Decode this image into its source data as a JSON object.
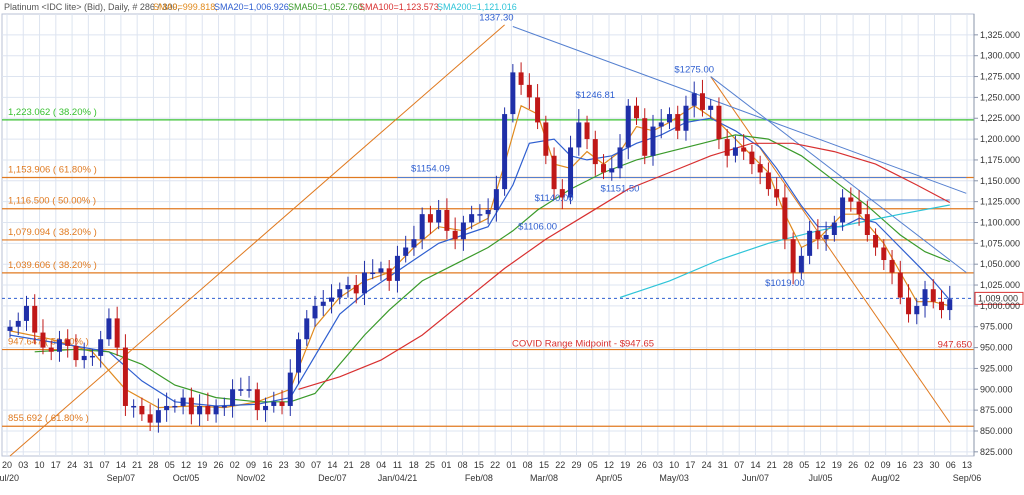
{
  "header": {
    "instrument": "Platinum <IDC lite> (Bid), Daily, # 286 / 300,",
    "sma9": "SMA9=999.818,",
    "sma20": "SMA20=1,006.926,",
    "sma50": "SMA50=1,052.760,",
    "sma100": "SMA100=1,123.573,",
    "sma200": "SMA200=1,121.016"
  },
  "colors": {
    "up_candle": "#1f2fa8",
    "down_candle": "#c01818",
    "sma9": "#e08a1e",
    "sma20": "#2f5fd0",
    "sma50": "#3a9a2a",
    "sma100": "#d83030",
    "sma200": "#2ec4d8",
    "fib_lines": "#e07a20",
    "fib_green": "#38c030",
    "trend_lines": "#5580d0",
    "grid": "#dde4f0"
  },
  "chart_data": {
    "type": "candlestick",
    "y_axis": {
      "range": [
        820,
        1350
      ],
      "ticks": [
        825,
        850,
        875,
        900,
        925,
        950,
        975,
        1000,
        1025,
        1050,
        1075,
        1100,
        1125,
        1150,
        1175,
        1200,
        1225,
        1250,
        1275,
        1300,
        1325
      ],
      "tick_labels": [
        "825.000",
        "850.000",
        "875.000",
        "900.000",
        "925.000",
        "950.000",
        "975.000",
        "1,000.000",
        "1,025.000",
        "1,050.000",
        "1,075.000",
        "1,100.000",
        "1,125.000",
        "1,150.000",
        "1,175.000",
        "1,200.000",
        "1,225.000",
        "1,250.000",
        "1,275.000",
        "1,300.000",
        "1,325.000"
      ]
    },
    "x_axis": {
      "day_ticks": [
        "20",
        "03",
        "10",
        "17",
        "24",
        "31",
        "07",
        "14",
        "21",
        "28",
        "05",
        "12",
        "19",
        "26",
        "02",
        "09",
        "16",
        "23",
        "30",
        "07",
        "14",
        "21",
        "28",
        "04",
        "11",
        "18",
        "25",
        "01",
        "08",
        "15",
        "22",
        "01",
        "08",
        "15",
        "22",
        "29",
        "05",
        "12",
        "19",
        "26",
        "03",
        "10",
        "17",
        "24",
        "31",
        "07",
        "14",
        "21",
        "28",
        "05",
        "12",
        "19",
        "26",
        "02",
        "09",
        "16",
        "23",
        "30",
        "06",
        "13"
      ],
      "month_labels": [
        {
          "label": "Jul/20",
          "slot": 0
        },
        {
          "label": "Sep/07",
          "slot": 7
        },
        {
          "label": "Oct/05",
          "slot": 11
        },
        {
          "label": "Nov/02",
          "slot": 15
        },
        {
          "label": "Dec/07",
          "slot": 20
        },
        {
          "label": "Jan/04/21",
          "slot": 24
        },
        {
          "label": "Feb/08",
          "slot": 29
        },
        {
          "label": "Mar/08",
          "slot": 33
        },
        {
          "label": "Apr/05",
          "slot": 37
        },
        {
          "label": "May/03",
          "slot": 41
        },
        {
          "label": "Jun/07",
          "slot": 46
        },
        {
          "label": "Jul/05",
          "slot": 50
        },
        {
          "label": "Aug/02",
          "slot": 54
        },
        {
          "label": "Sep/06",
          "slot": 59
        }
      ]
    },
    "close_series": [
      [
        0,
        975
      ],
      [
        1,
        982
      ],
      [
        2,
        1000
      ],
      [
        3,
        968
      ],
      [
        4,
        950
      ],
      [
        5,
        945
      ],
      [
        6,
        960
      ],
      [
        7,
        952
      ],
      [
        8,
        935
      ],
      [
        9,
        940
      ],
      [
        10,
        940
      ],
      [
        11,
        960
      ],
      [
        12,
        985
      ],
      [
        13,
        950
      ],
      [
        14,
        880
      ],
      [
        15,
        880
      ],
      [
        16,
        870
      ],
      [
        17,
        860
      ],
      [
        18,
        875
      ],
      [
        19,
        880
      ],
      [
        20,
        880
      ],
      [
        21,
        890
      ],
      [
        22,
        870
      ],
      [
        23,
        880
      ],
      [
        24,
        870
      ],
      [
        25,
        880
      ],
      [
        26,
        880
      ],
      [
        27,
        900
      ],
      [
        28,
        900
      ],
      [
        29,
        900
      ],
      [
        30,
        875
      ],
      [
        31,
        880
      ],
      [
        32,
        885
      ],
      [
        33,
        880
      ],
      [
        34,
        920
      ],
      [
        35,
        960
      ],
      [
        36,
        985
      ],
      [
        37,
        1000
      ],
      [
        38,
        1005
      ],
      [
        39,
        1010
      ],
      [
        40,
        1020
      ],
      [
        41,
        1025
      ],
      [
        42,
        1015
      ],
      [
        43,
        1040
      ],
      [
        44,
        1040
      ],
      [
        45,
        1045
      ],
      [
        46,
        1030
      ],
      [
        47,
        1060
      ],
      [
        48,
        1070
      ],
      [
        49,
        1080
      ],
      [
        50,
        1110
      ],
      [
        51,
        1100
      ],
      [
        52,
        1115
      ],
      [
        53,
        1090
      ],
      [
        54,
        1080
      ],
      [
        55,
        1100
      ],
      [
        56,
        1110
      ],
      [
        57,
        1110
      ],
      [
        58,
        1115
      ],
      [
        59,
        1140
      ],
      [
        60,
        1230
      ],
      [
        61,
        1280
      ],
      [
        62,
        1265
      ],
      [
        63,
        1250
      ],
      [
        64,
        1220
      ],
      [
        65,
        1180
      ],
      [
        66,
        1140
      ],
      [
        67,
        1130
      ],
      [
        68,
        1190
      ],
      [
        69,
        1220
      ],
      [
        70,
        1200
      ],
      [
        71,
        1170
      ],
      [
        72,
        1160
      ],
      [
        73,
        1165
      ],
      [
        74,
        1190
      ],
      [
        75,
        1240
      ],
      [
        76,
        1225
      ],
      [
        77,
        1180
      ],
      [
        78,
        1215
      ],
      [
        79,
        1220
      ],
      [
        80,
        1230
      ],
      [
        81,
        1210
      ],
      [
        82,
        1240
      ],
      [
        83,
        1255
      ],
      [
        84,
        1235
      ],
      [
        85,
        1240
      ],
      [
        86,
        1200
      ],
      [
        87,
        1180
      ],
      [
        88,
        1190
      ],
      [
        89,
        1185
      ],
      [
        90,
        1170
      ],
      [
        91,
        1160
      ],
      [
        92,
        1140
      ],
      [
        93,
        1130
      ],
      [
        94,
        1080
      ],
      [
        95,
        1040
      ],
      [
        96,
        1060
      ],
      [
        97,
        1090
      ],
      [
        98,
        1080
      ],
      [
        99,
        1085
      ],
      [
        100,
        1100
      ],
      [
        101,
        1130
      ],
      [
        102,
        1125
      ],
      [
        103,
        1110
      ],
      [
        104,
        1085
      ],
      [
        105,
        1070
      ],
      [
        106,
        1055
      ],
      [
        107,
        1040
      ],
      [
        108,
        1010
      ],
      [
        109,
        990
      ],
      [
        110,
        1000
      ],
      [
        111,
        1020
      ],
      [
        112,
        1005
      ],
      [
        113,
        995
      ],
      [
        114,
        1008
      ]
    ],
    "moving_averages": [
      {
        "name": "SMA9",
        "points": [
          [
            0,
            970
          ],
          [
            5,
            960
          ],
          [
            10,
            945
          ],
          [
            14,
            900
          ],
          [
            18,
            878
          ],
          [
            22,
            880
          ],
          [
            26,
            878
          ],
          [
            30,
            885
          ],
          [
            34,
            900
          ],
          [
            37,
            975
          ],
          [
            40,
            1010
          ],
          [
            43,
            1030
          ],
          [
            46,
            1040
          ],
          [
            49,
            1070
          ],
          [
            52,
            1095
          ],
          [
            55,
            1090
          ],
          [
            58,
            1105
          ],
          [
            60,
            1170
          ],
          [
            62,
            1240
          ],
          [
            64,
            1230
          ],
          [
            66,
            1170
          ],
          [
            68,
            1165
          ],
          [
            70,
            1185
          ],
          [
            72,
            1170
          ],
          [
            74,
            1185
          ],
          [
            76,
            1215
          ],
          [
            78,
            1210
          ],
          [
            80,
            1220
          ],
          [
            83,
            1240
          ],
          [
            86,
            1220
          ],
          [
            89,
            1190
          ],
          [
            92,
            1160
          ],
          [
            94,
            1110
          ],
          [
            96,
            1070
          ],
          [
            98,
            1080
          ],
          [
            101,
            1110
          ],
          [
            103,
            1110
          ],
          [
            106,
            1075
          ],
          [
            108,
            1040
          ],
          [
            110,
            1005
          ],
          [
            112,
            1005
          ],
          [
            114,
            1000
          ]
        ]
      },
      {
        "name": "SMA20",
        "points": [
          [
            0,
            965
          ],
          [
            6,
            955
          ],
          [
            12,
            945
          ],
          [
            16,
            910
          ],
          [
            20,
            885
          ],
          [
            25,
            880
          ],
          [
            30,
            882
          ],
          [
            34,
            890
          ],
          [
            37,
            940
          ],
          [
            40,
            990
          ],
          [
            43,
            1015
          ],
          [
            46,
            1035
          ],
          [
            49,
            1055
          ],
          [
            52,
            1075
          ],
          [
            55,
            1085
          ],
          [
            58,
            1095
          ],
          [
            61,
            1145
          ],
          [
            63,
            1195
          ],
          [
            66,
            1200
          ],
          [
            68,
            1180
          ],
          [
            70,
            1175
          ],
          [
            73,
            1180
          ],
          [
            76,
            1195
          ],
          [
            79,
            1205
          ],
          [
            82,
            1220
          ],
          [
            85,
            1225
          ],
          [
            88,
            1210
          ],
          [
            91,
            1190
          ],
          [
            93,
            1165
          ],
          [
            96,
            1120
          ],
          [
            98,
            1095
          ],
          [
            101,
            1095
          ],
          [
            103,
            1105
          ],
          [
            105,
            1100
          ],
          [
            108,
            1070
          ],
          [
            110,
            1050
          ],
          [
            112,
            1030
          ],
          [
            114,
            1007
          ]
        ]
      },
      {
        "name": "SMA50",
        "points": [
          [
            3,
            945
          ],
          [
            8,
            948
          ],
          [
            12,
            945
          ],
          [
            16,
            930
          ],
          [
            20,
            905
          ],
          [
            25,
            890
          ],
          [
            30,
            885
          ],
          [
            34,
            885
          ],
          [
            37,
            895
          ],
          [
            40,
            930
          ],
          [
            43,
            965
          ],
          [
            46,
            995
          ],
          [
            50,
            1030
          ],
          [
            54,
            1050
          ],
          [
            58,
            1070
          ],
          [
            61,
            1090
          ],
          [
            64,
            1115
          ],
          [
            68,
            1140
          ],
          [
            72,
            1160
          ],
          [
            76,
            1175
          ],
          [
            80,
            1185
          ],
          [
            84,
            1195
          ],
          [
            88,
            1205
          ],
          [
            92,
            1200
          ],
          [
            96,
            1180
          ],
          [
            100,
            1150
          ],
          [
            104,
            1120
          ],
          [
            108,
            1085
          ],
          [
            111,
            1065
          ],
          [
            114,
            1053
          ]
        ]
      },
      {
        "name": "SMA100",
        "points": [
          [
            35,
            900
          ],
          [
            40,
            915
          ],
          [
            45,
            935
          ],
          [
            50,
            965
          ],
          [
            55,
            1005
          ],
          [
            60,
            1045
          ],
          [
            65,
            1080
          ],
          [
            70,
            1110
          ],
          [
            75,
            1140
          ],
          [
            80,
            1160
          ],
          [
            85,
            1180
          ],
          [
            90,
            1195
          ],
          [
            95,
            1195
          ],
          [
            100,
            1185
          ],
          [
            105,
            1170
          ],
          [
            110,
            1145
          ],
          [
            114,
            1124
          ]
        ]
      },
      {
        "name": "SMA200",
        "points": [
          [
            74,
            1010
          ],
          [
            80,
            1030
          ],
          [
            86,
            1055
          ],
          [
            92,
            1075
          ],
          [
            98,
            1090
          ],
          [
            103,
            1100
          ],
          [
            108,
            1110
          ],
          [
            114,
            1121
          ]
        ]
      }
    ],
    "annotations": [
      {
        "text": "1337.30",
        "value": 1337.3
      },
      {
        "text": "$1275.00",
        "value": 1275
      },
      {
        "text": "$1246.81",
        "value": 1246.81
      },
      {
        "text": "$1154.09",
        "value": 1154.09
      },
      {
        "text": "$1151.50",
        "value": 1151.5
      },
      {
        "text": "$1140.00",
        "value": 1140
      },
      {
        "text": "$1106.00",
        "value": 1106
      },
      {
        "text": "$1019.00",
        "value": 1019
      }
    ],
    "horizontal_levels": [
      {
        "label": "1,223.062 ( 38.20% )",
        "value": 1223.062,
        "style": "green"
      },
      {
        "label": "1,153.906 ( 61.80% )",
        "value": 1153.906,
        "style": "orange"
      },
      {
        "label": "1,116.500 ( 50.00% )",
        "value": 1116.5,
        "style": "orange"
      },
      {
        "label": "1,079.094 ( 38.20% )",
        "value": 1079.094,
        "style": "orange"
      },
      {
        "label": "1,039.606 ( 38.20% )",
        "value": 1039.606,
        "style": "orange"
      },
      {
        "label": "947.650",
        "value": 947.65,
        "style": "orange"
      },
      {
        "label": "855.692 ( 61.80% )",
        "value": 855.692,
        "style": "orange"
      },
      {
        "label": "947.647 ( 50.00% )",
        "value": 947.65,
        "style": "orange"
      }
    ],
    "midpoint_label": "COVID Range Midpoint - $947.65",
    "last_price": "1,009.000",
    "last_price_value": 1009
  }
}
